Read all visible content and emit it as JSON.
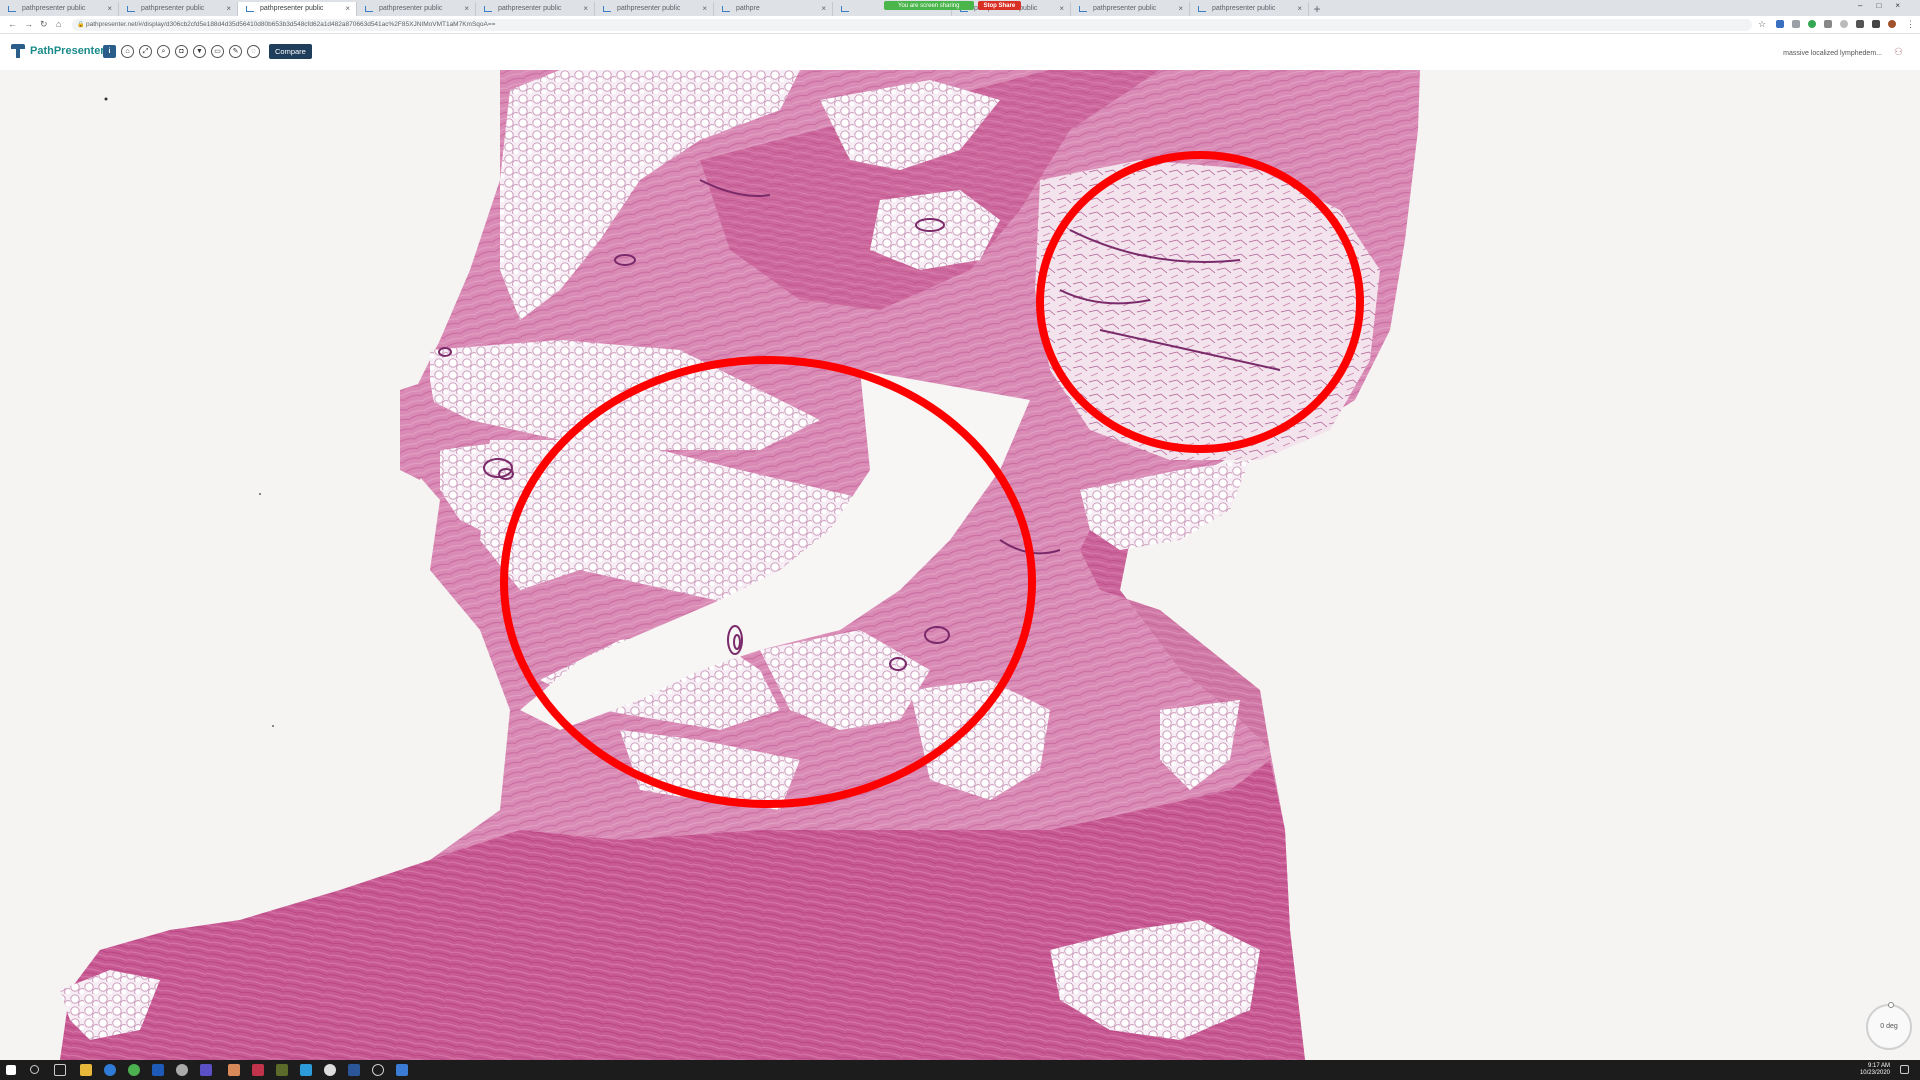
{
  "browser": {
    "tabs": [
      {
        "title": "pathpresenter public",
        "active": false
      },
      {
        "title": "pathpresenter public",
        "active": false
      },
      {
        "title": "pathpresenter public",
        "active": true
      },
      {
        "title": "pathpresenter public",
        "active": false
      },
      {
        "title": "pathpresenter public",
        "active": false
      },
      {
        "title": "pathpresenter public",
        "active": false
      },
      {
        "title": "pathpre",
        "active": false
      },
      {
        "title": "",
        "active": false
      },
      {
        "title": "pathpresenter public",
        "active": false
      },
      {
        "title": "pathpresenter public",
        "active": false
      },
      {
        "title": "pathpresenter public",
        "active": false
      }
    ],
    "new_tab_label": "+",
    "screen_share_banner": "You are screen sharing",
    "stop_share_label": "Stop Share",
    "url": "pathpresenter.net/#/display/d306cb2cfd5e188d4d35d56410d80b653b3d548cfd62a1d482a870663d541ac%2F85XJNIMoVMT1aM7KmSqoA=="
  },
  "app": {
    "logo_text": "PathPresenter",
    "toolbar_icons": [
      "info-icon",
      "home-icon",
      "fullscreen-icon",
      "zoom-icon",
      "camera-icon",
      "filter-icon",
      "monitor-icon",
      "pen-icon",
      "rotate-icon"
    ],
    "compare_label": "Compare",
    "slide_name": "massive localized lymphedem..."
  },
  "viewer": {
    "rotation_label": "0 deg",
    "annotation_color": "#ff0000",
    "stain_colors": {
      "stroma": "#d67fae",
      "dense_stroma": "#c9528f",
      "fat": "#f3e8f0",
      "background": "#f5f4f2"
    }
  },
  "taskbar": {
    "time": "9:17 AM",
    "date": "10/23/2020"
  }
}
